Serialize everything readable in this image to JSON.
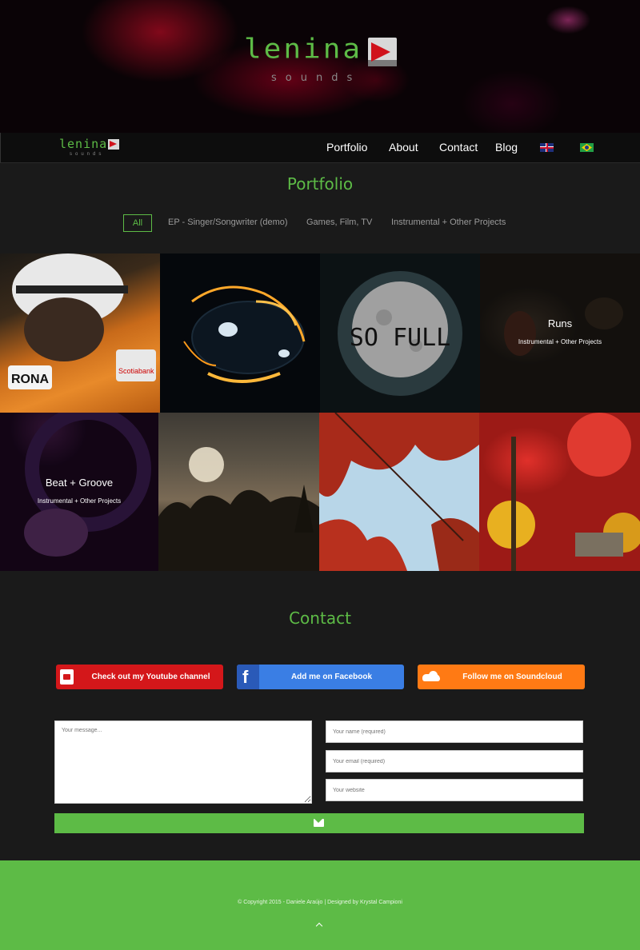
{
  "hero": {
    "logo_word": "lenina",
    "logo_sub": "sounds"
  },
  "nav": {
    "logo_word": "lenina",
    "logo_sub": "sounds",
    "items": [
      "Portfolio",
      "About",
      "Contact",
      "Blog"
    ],
    "flags": [
      "uk-flag-icon",
      "brazil-flag-icon"
    ]
  },
  "portfolio": {
    "title": "Portfolio",
    "filters": [
      "All",
      "EP - Singer/Songwriter (demo)",
      "Games, Film, TV",
      "Instrumental + Other Projects"
    ],
    "active_filter": "All",
    "tiles": [
      {
        "title": "",
        "category": "",
        "art_text": ""
      },
      {
        "title": "",
        "category": ""
      },
      {
        "title": "",
        "category": "",
        "art_text": "SO FULL"
      },
      {
        "title": "Runs",
        "category": "Instrumental + Other Projects"
      },
      {
        "title": "Beat + Groove",
        "category": "Instrumental + Other Projects"
      },
      {
        "title": "",
        "category": ""
      },
      {
        "title": "",
        "category": ""
      },
      {
        "title": "",
        "category": ""
      }
    ]
  },
  "contact": {
    "title": "Contact",
    "buttons": {
      "youtube": "Check out my Youtube channel",
      "facebook": "Add me on Facebook",
      "soundcloud": "Follow me on Soundcloud"
    },
    "form": {
      "message_placeholder": "Your message...",
      "name_placeholder": "Your name (required)",
      "email_placeholder": "Your email (required)",
      "website_placeholder": "Your website"
    }
  },
  "footer": {
    "copyright": "© Copyright 2015 - Daniele Araújo | Designed by Krystal Campioni"
  },
  "colors": {
    "accent": "#5dbb46",
    "youtube": "#d4171a",
    "facebook": "#3a7ee4",
    "soundcloud": "#ff7a14"
  }
}
